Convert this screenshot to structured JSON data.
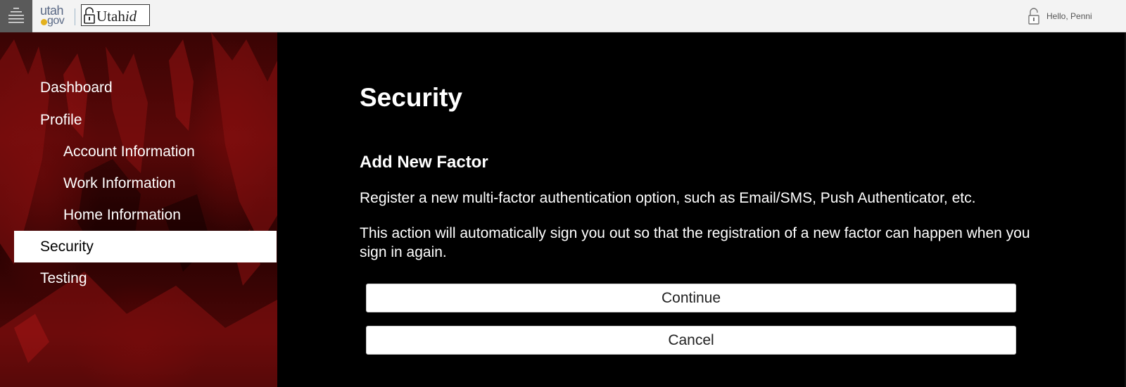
{
  "header": {
    "menu_icon": "hamburger-menu-icon",
    "utah_logo": {
      "word1": "utah",
      "word2": "gov",
      "dot_color": "#e3b11e"
    },
    "utahid_logo": {
      "prefix": "Utah",
      "suffix": "id"
    },
    "user_icon": "lock-icon",
    "greeting": "Hello, Penni"
  },
  "sidebar": {
    "items": [
      {
        "label": "Dashboard",
        "level": 0,
        "active": false
      },
      {
        "label": "Profile",
        "level": 0,
        "active": false
      },
      {
        "label": "Account Information",
        "level": 1,
        "active": false
      },
      {
        "label": "Work Information",
        "level": 1,
        "active": false
      },
      {
        "label": "Home Information",
        "level": 1,
        "active": false
      },
      {
        "label": "Security",
        "level": 0,
        "active": true
      },
      {
        "label": "Testing",
        "level": 0,
        "active": false
      }
    ]
  },
  "main": {
    "title": "Security",
    "section_title": "Add New Factor",
    "description": "Register a new multi-factor authentication option, such as Email/SMS, Push Authenticator, etc.",
    "notice": "This action will automatically sign you out so that the registration of a new factor can happen when you sign in again.",
    "continue_label": "Continue",
    "cancel_label": "Cancel"
  },
  "colors": {
    "sidebar_accent": "#5a0808",
    "active_item_bg": "#ffffff",
    "main_bg": "#000000",
    "topbar_bg": "#f3f3f3"
  }
}
